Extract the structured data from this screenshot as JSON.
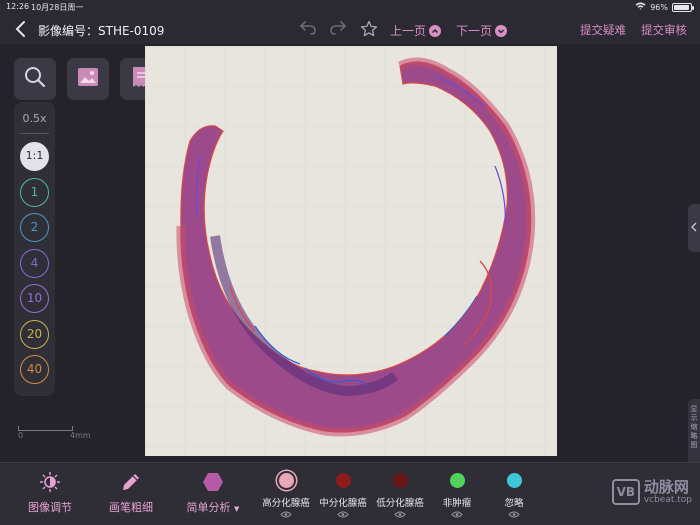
{
  "status": {
    "time": "12:26",
    "date": "10月28日周一",
    "battery": "96%",
    "battery_level": 0.96
  },
  "header": {
    "title": "影像编号：STHE-0109",
    "prev": "上一页",
    "next": "下一页",
    "submit_question": "提交疑难",
    "submit_review": "提交审核"
  },
  "zoom": {
    "current": "0.5x",
    "levels": [
      {
        "label": "1:1",
        "color": "#e3e1ea",
        "active": true
      },
      {
        "label": "1",
        "color": "#4fb79b"
      },
      {
        "label": "2",
        "color": "#4a9ac4"
      },
      {
        "label": "4",
        "color": "#7c6fd0"
      },
      {
        "label": "10",
        "color": "#9a6bcf"
      },
      {
        "label": "20",
        "color": "#c8b24a"
      },
      {
        "label": "40",
        "color": "#d08a45"
      }
    ]
  },
  "scalebar": {
    "left": "0",
    "right": "4mm"
  },
  "side_panel_label": "显示缩略图",
  "toolbar": {
    "image_adjust": "图像调节",
    "pen_width": "画笔粗细",
    "simple_analysis": "简单分析"
  },
  "labels": [
    {
      "name": "高分化腺癌",
      "color": "#e8a9b4",
      "selected": true
    },
    {
      "name": "中分化腺癌",
      "color": "#8e1c1c"
    },
    {
      "name": "低分化腺癌",
      "color": "#6b1616"
    },
    {
      "name": "非肿瘤",
      "color": "#4fd35a"
    },
    {
      "name": "忽略",
      "color": "#3fc6d8"
    }
  ],
  "watermark": {
    "logo": "VB",
    "text": "动脉网",
    "sub": "vcbeat.top"
  }
}
